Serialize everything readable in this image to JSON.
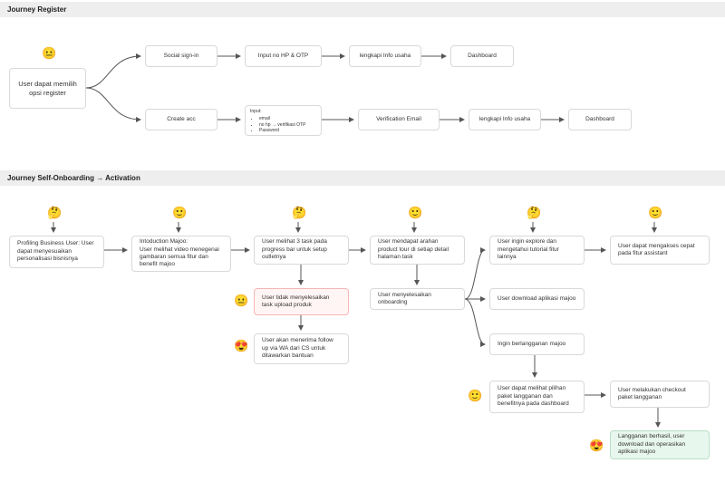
{
  "section1": {
    "title": "Journey Register"
  },
  "section2": {
    "title": "Journey Self-Onboarding → Activation"
  },
  "reg": {
    "start": "User dapat memilih opsi register",
    "social": "Social sign-in",
    "create": "Create acc",
    "otp": "Input no HP & OTP",
    "input_hdr": "Input:",
    "input_email": "email",
    "input_hp": "no hp → verifikasi OTP",
    "input_pw": "Password",
    "lengkapi": "lengkapi Info usaha",
    "verif": "Verification Email",
    "dash": "Dashboard"
  },
  "ob": {
    "c1": "Profiling Business User: User dapat menyesuaikan personalisasi bisnisnya",
    "c2": "Intoduction Majoo:\nUser melihat video menegenai gambaran semua fitur dan benefit majoo",
    "c3": "User melihat 3 task pada progress bar untuk setup outletnya",
    "c3a": "User tidak menyelesaikan task upload produk",
    "c3b": "User akan menerima follow up via WA dari CS untuk ditawarkan bantuan",
    "c4": "User mendapat arahan product tour di setiap detail halaman task",
    "c4a": "User menyelesaikan onboarding",
    "c5a": "User ingin explore dan mengetahui tutorial fitur lainnya",
    "c5b": "User download aplikasi majoo",
    "c5c": "Ingin berlangganan majoo",
    "c5d": "User dapat melihat pilihan paket langganan dan benefitnya pada dashboard",
    "c6a": "User dapat mengakses cepat pada fitur assistant",
    "c6b": "User melakukan checkout paket langganan",
    "c6c": "Langganan berhasil, user download dan operasikan aplikasi majoo"
  },
  "emoji": {
    "neutral": "😐",
    "think": "🤔",
    "smile": "🙂",
    "love": "😍"
  }
}
